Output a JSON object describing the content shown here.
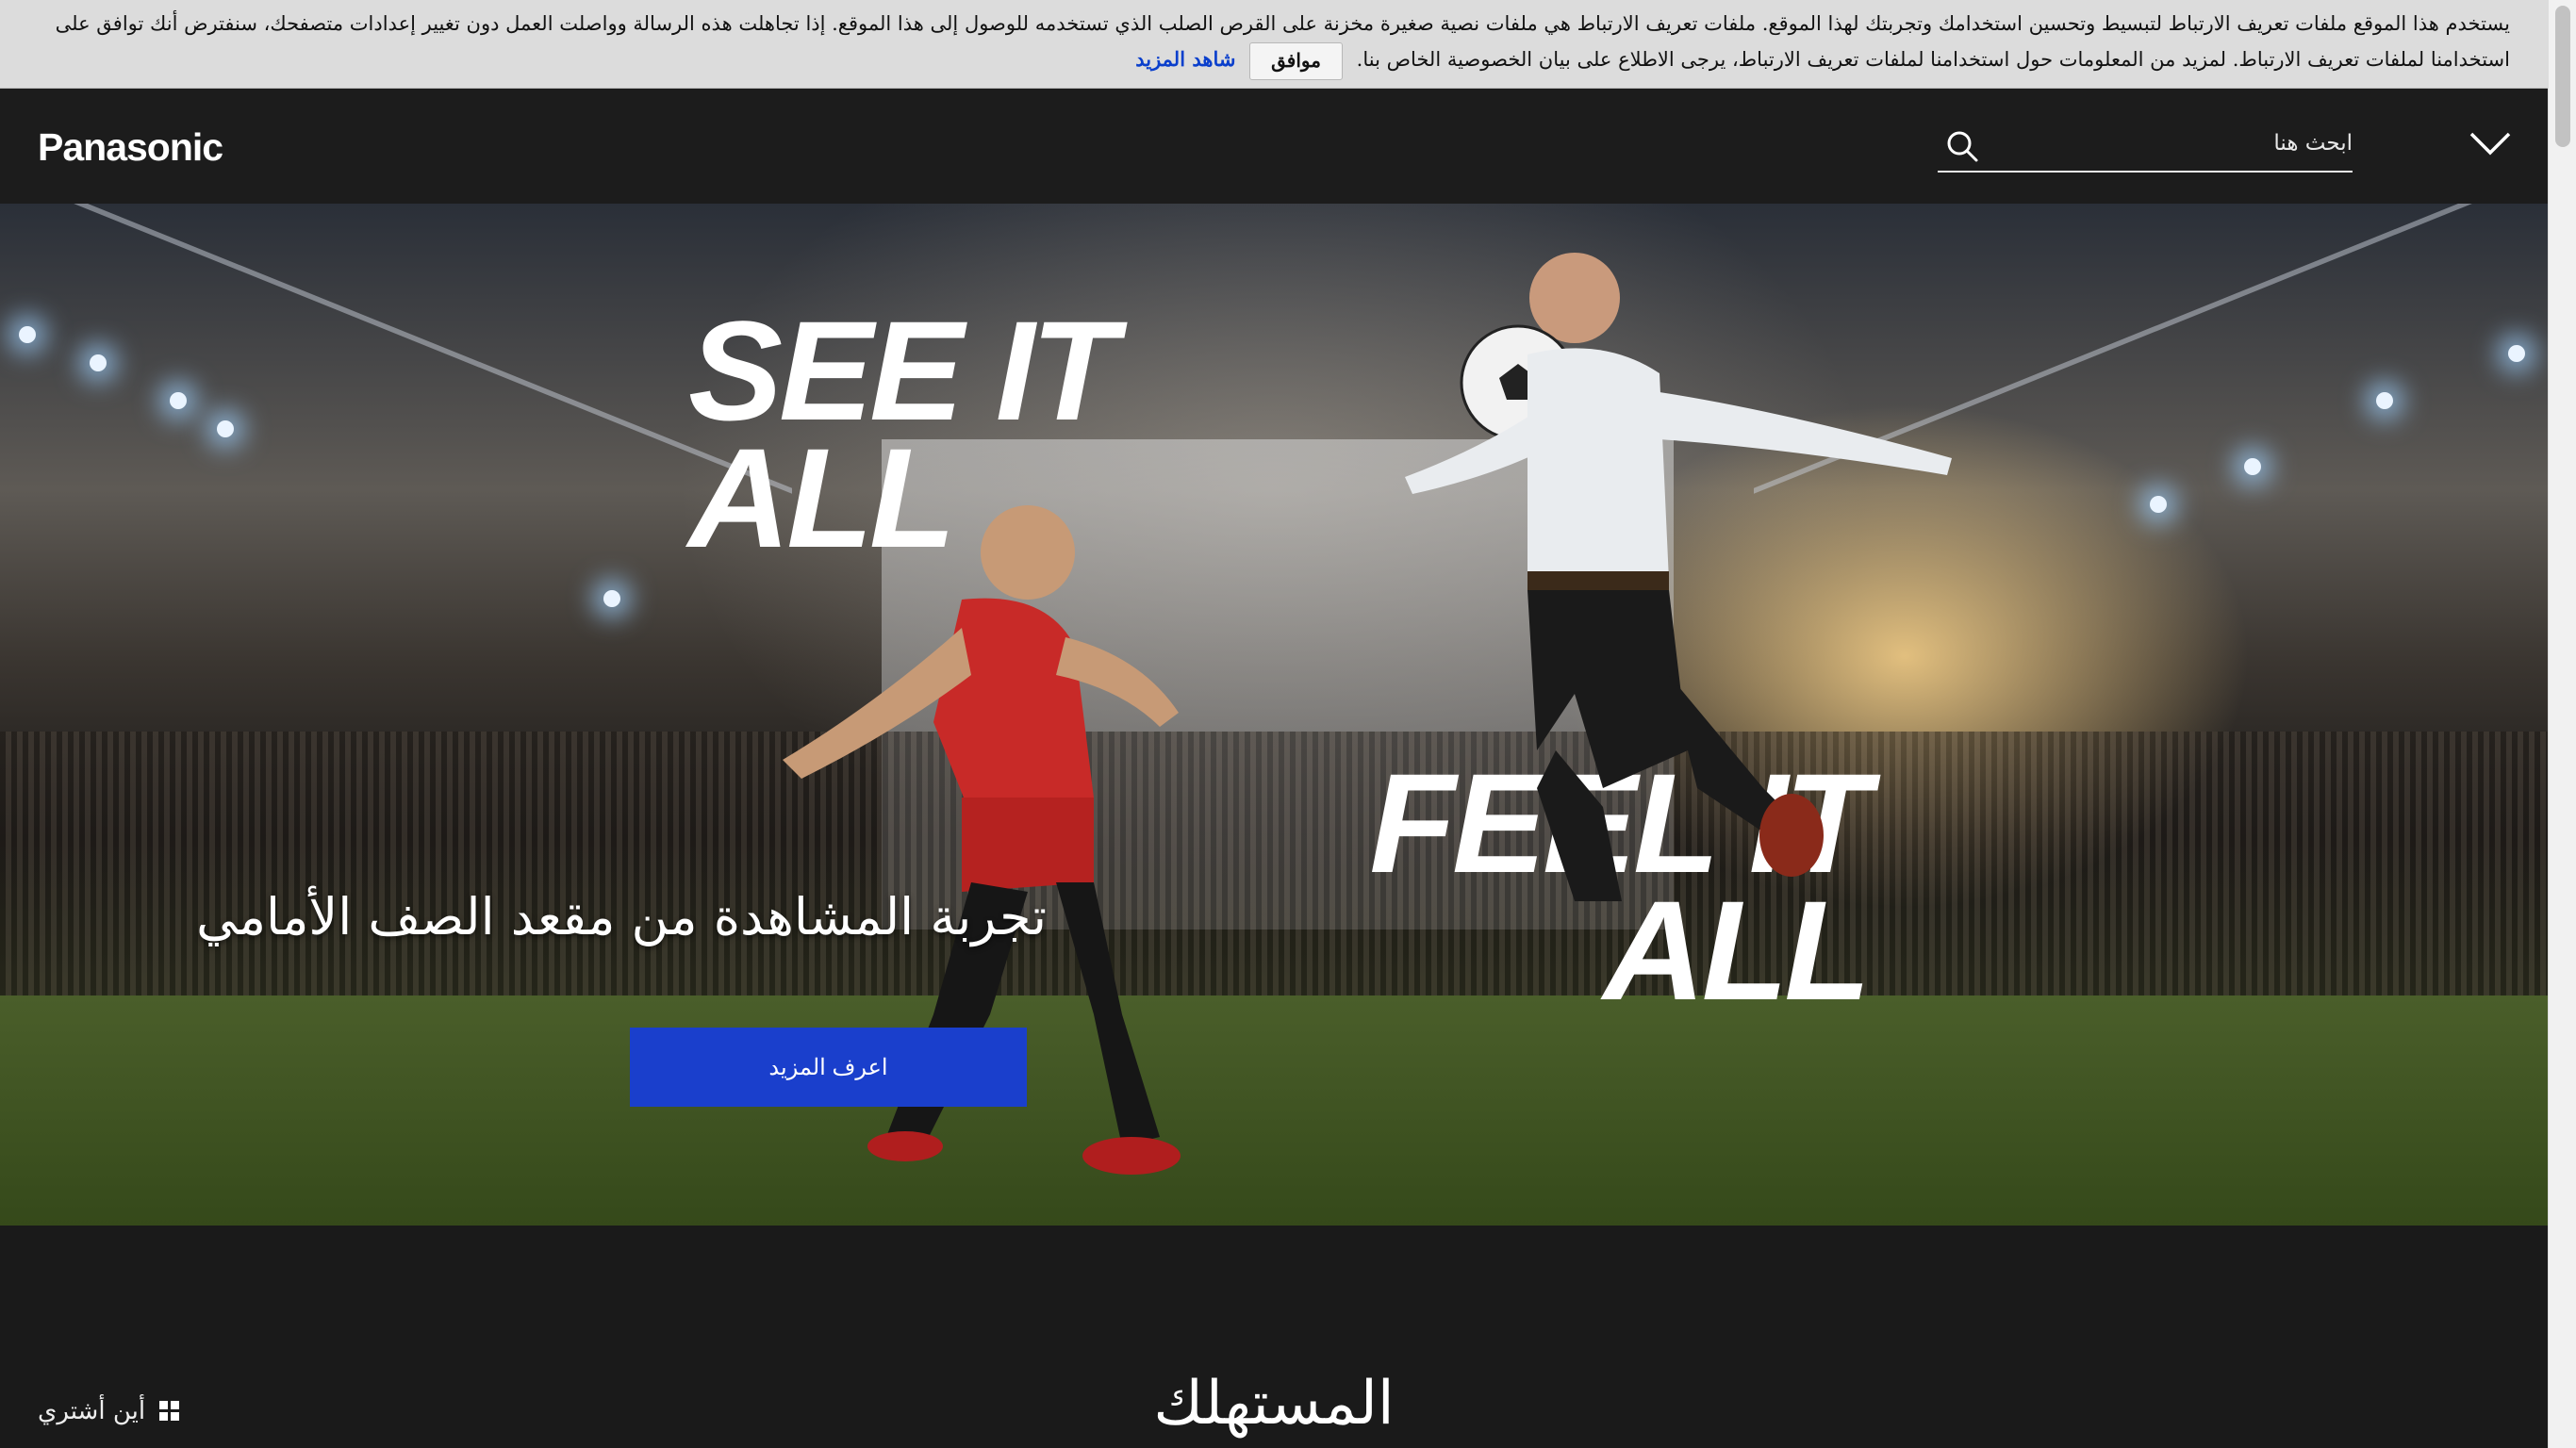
{
  "cookie_banner": {
    "text": "يستخدم هذا الموقع ملفات تعريف الارتباط لتبسيط وتحسين استخدامك وتجربتك لهذا الموقع. ملفات تعريف الارتباط هي ملفات نصية صغيرة مخزنة على القرص الصلب الذي تستخدمه للوصول إلى هذا الموقع. إذا تجاهلت هذه الرسالة وواصلت العمل دون تغيير إعدادات متصفحك، سنفترض أنك توافق على استخدامنا لملفات تعريف الارتباط. لمزيد من المعلومات حول استخدامنا لملفات تعريف الارتباط، يرجى الاطلاع على بيان الخصوصية الخاص بنا.",
    "ok_label": "موافق",
    "more_label": "شاهد المزيد"
  },
  "header": {
    "logo": "Panasonic",
    "search_placeholder": "ابحث هنا"
  },
  "hero": {
    "slogan_top": "SEE IT ALL",
    "slogan_bottom": "FEEL IT ALL",
    "headline": "تجربة المشاهدة من مقعد الصف الأمامي",
    "cta_label": "اعرف المزيد"
  },
  "section": {
    "title": "المستهلك",
    "where_to_buy": "أين أشتري"
  },
  "colors": {
    "cta": "#1a3fcc",
    "link": "#0a3fcc",
    "header_bg": "#1c1c1c"
  }
}
